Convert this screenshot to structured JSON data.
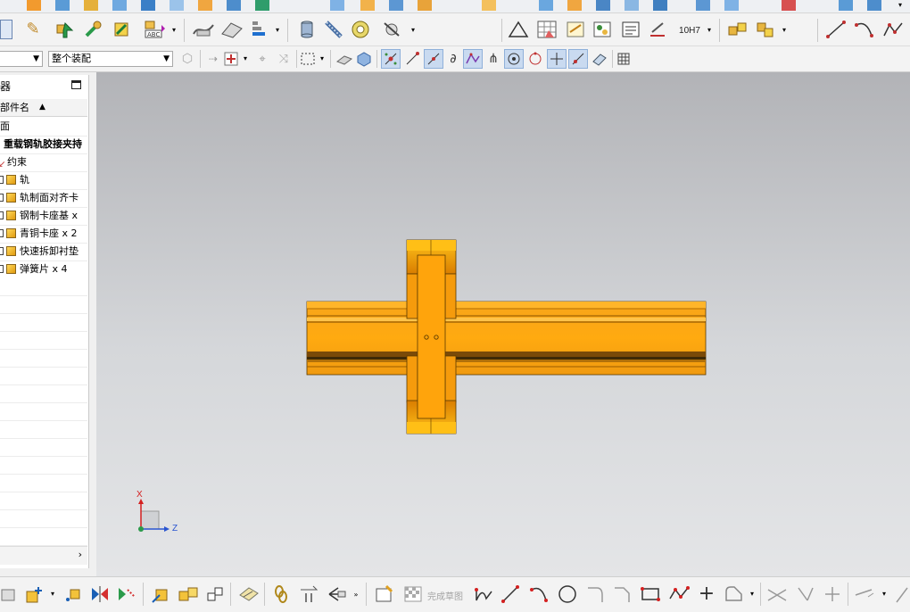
{
  "toolbar": {
    "assembly_filter_value": "",
    "assembly_scope_value": "整个装配",
    "dim_label": "10H7",
    "finish_sketch_label": "完成草图"
  },
  "navigator": {
    "title": "器",
    "column_header": "部件名",
    "rows": [
      {
        "label": "面",
        "bold": false,
        "icon": "none"
      },
      {
        "label": "重载钢轨胶接夹持",
        "bold": true,
        "icon": "none"
      },
      {
        "label": "约束",
        "bold": false,
        "icon": "constraint-icon"
      },
      {
        "label": "轨",
        "bold": false,
        "icon": "component-icon"
      },
      {
        "label": "轨制面对齐卡",
        "bold": false,
        "icon": "component-icon"
      },
      {
        "label": "钢制卡座基 x",
        "bold": false,
        "icon": "component-icon"
      },
      {
        "label": "青铜卡座 x 2",
        "bold": false,
        "icon": "component-icon"
      },
      {
        "label": "快速拆卸衬垫",
        "bold": false,
        "icon": "component-icon"
      },
      {
        "label": "弹簧片 x 4",
        "bold": false,
        "icon": "component-icon"
      }
    ]
  },
  "triad": {
    "x_label": "X",
    "z_label": "Z"
  },
  "colors": {
    "part_orange": "#ffa20a",
    "viewport_top": "#b2b3b7",
    "viewport_bottom": "#e4e5e7"
  }
}
